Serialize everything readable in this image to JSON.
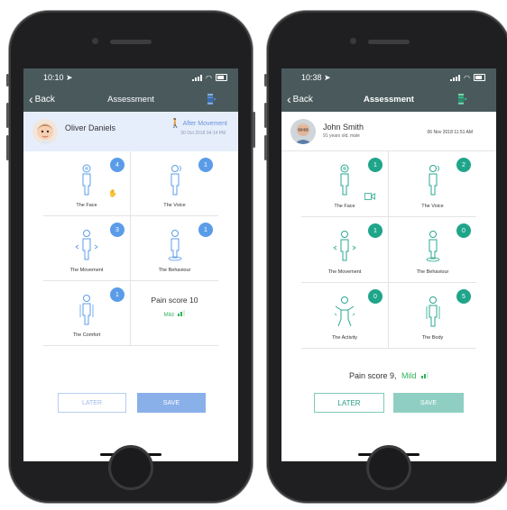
{
  "left_phone": {
    "status_time": "10:10",
    "nav": {
      "back_label": "Back",
      "title": "Assessment"
    },
    "patient": {
      "name": "Oliver Daniels",
      "tag": "After Movement",
      "date": "30 Oct 2018 04:14 PM"
    },
    "cells": [
      {
        "label": "The Face",
        "count": "4",
        "extra_icon": "hand-icon"
      },
      {
        "label": "The Voice",
        "count": "1"
      },
      {
        "label": "The Movement",
        "count": "3"
      },
      {
        "label": "The Behaviour",
        "count": "1"
      },
      {
        "label": "The Comfort",
        "count": "1"
      }
    ],
    "pain": {
      "text": "Pain score 10",
      "level": "Mild"
    },
    "buttons": {
      "later": "LATER",
      "save": "SAVE"
    },
    "colors": {
      "badge": "#5b9ce8",
      "icon": "#5b9ce8",
      "level": "#2fb35a",
      "save_bg": "#8ab0ea",
      "later_border": "#b7cdf0",
      "later_text": "#9db9ea"
    }
  },
  "right_phone": {
    "status_time": "10:38",
    "nav": {
      "back_label": "Back",
      "title": "Assessment"
    },
    "patient": {
      "name": "John Smith",
      "sub": "91 years old, male",
      "date": "06 Nov 2018 11:51 AM"
    },
    "cells": [
      {
        "label": "The Face",
        "count": "1",
        "extra_icon": "video-icon"
      },
      {
        "label": "The Voice",
        "count": "2"
      },
      {
        "label": "The Movement",
        "count": "1"
      },
      {
        "label": "The Behaviour",
        "count": "0"
      },
      {
        "label": "The Activity",
        "count": "0"
      },
      {
        "label": "The Body",
        "count": "5"
      }
    ],
    "pain": {
      "text": "Pain score 9,",
      "level": "Mild"
    },
    "buttons": {
      "later": "LATER",
      "save": "SAVE"
    },
    "colors": {
      "badge": "#1fa58a",
      "icon": "#2aa890",
      "level": "#2fb35a",
      "save_bg": "#8fcfc3",
      "later_border": "#7fc8b8",
      "later_text": "#2a9c84"
    }
  }
}
